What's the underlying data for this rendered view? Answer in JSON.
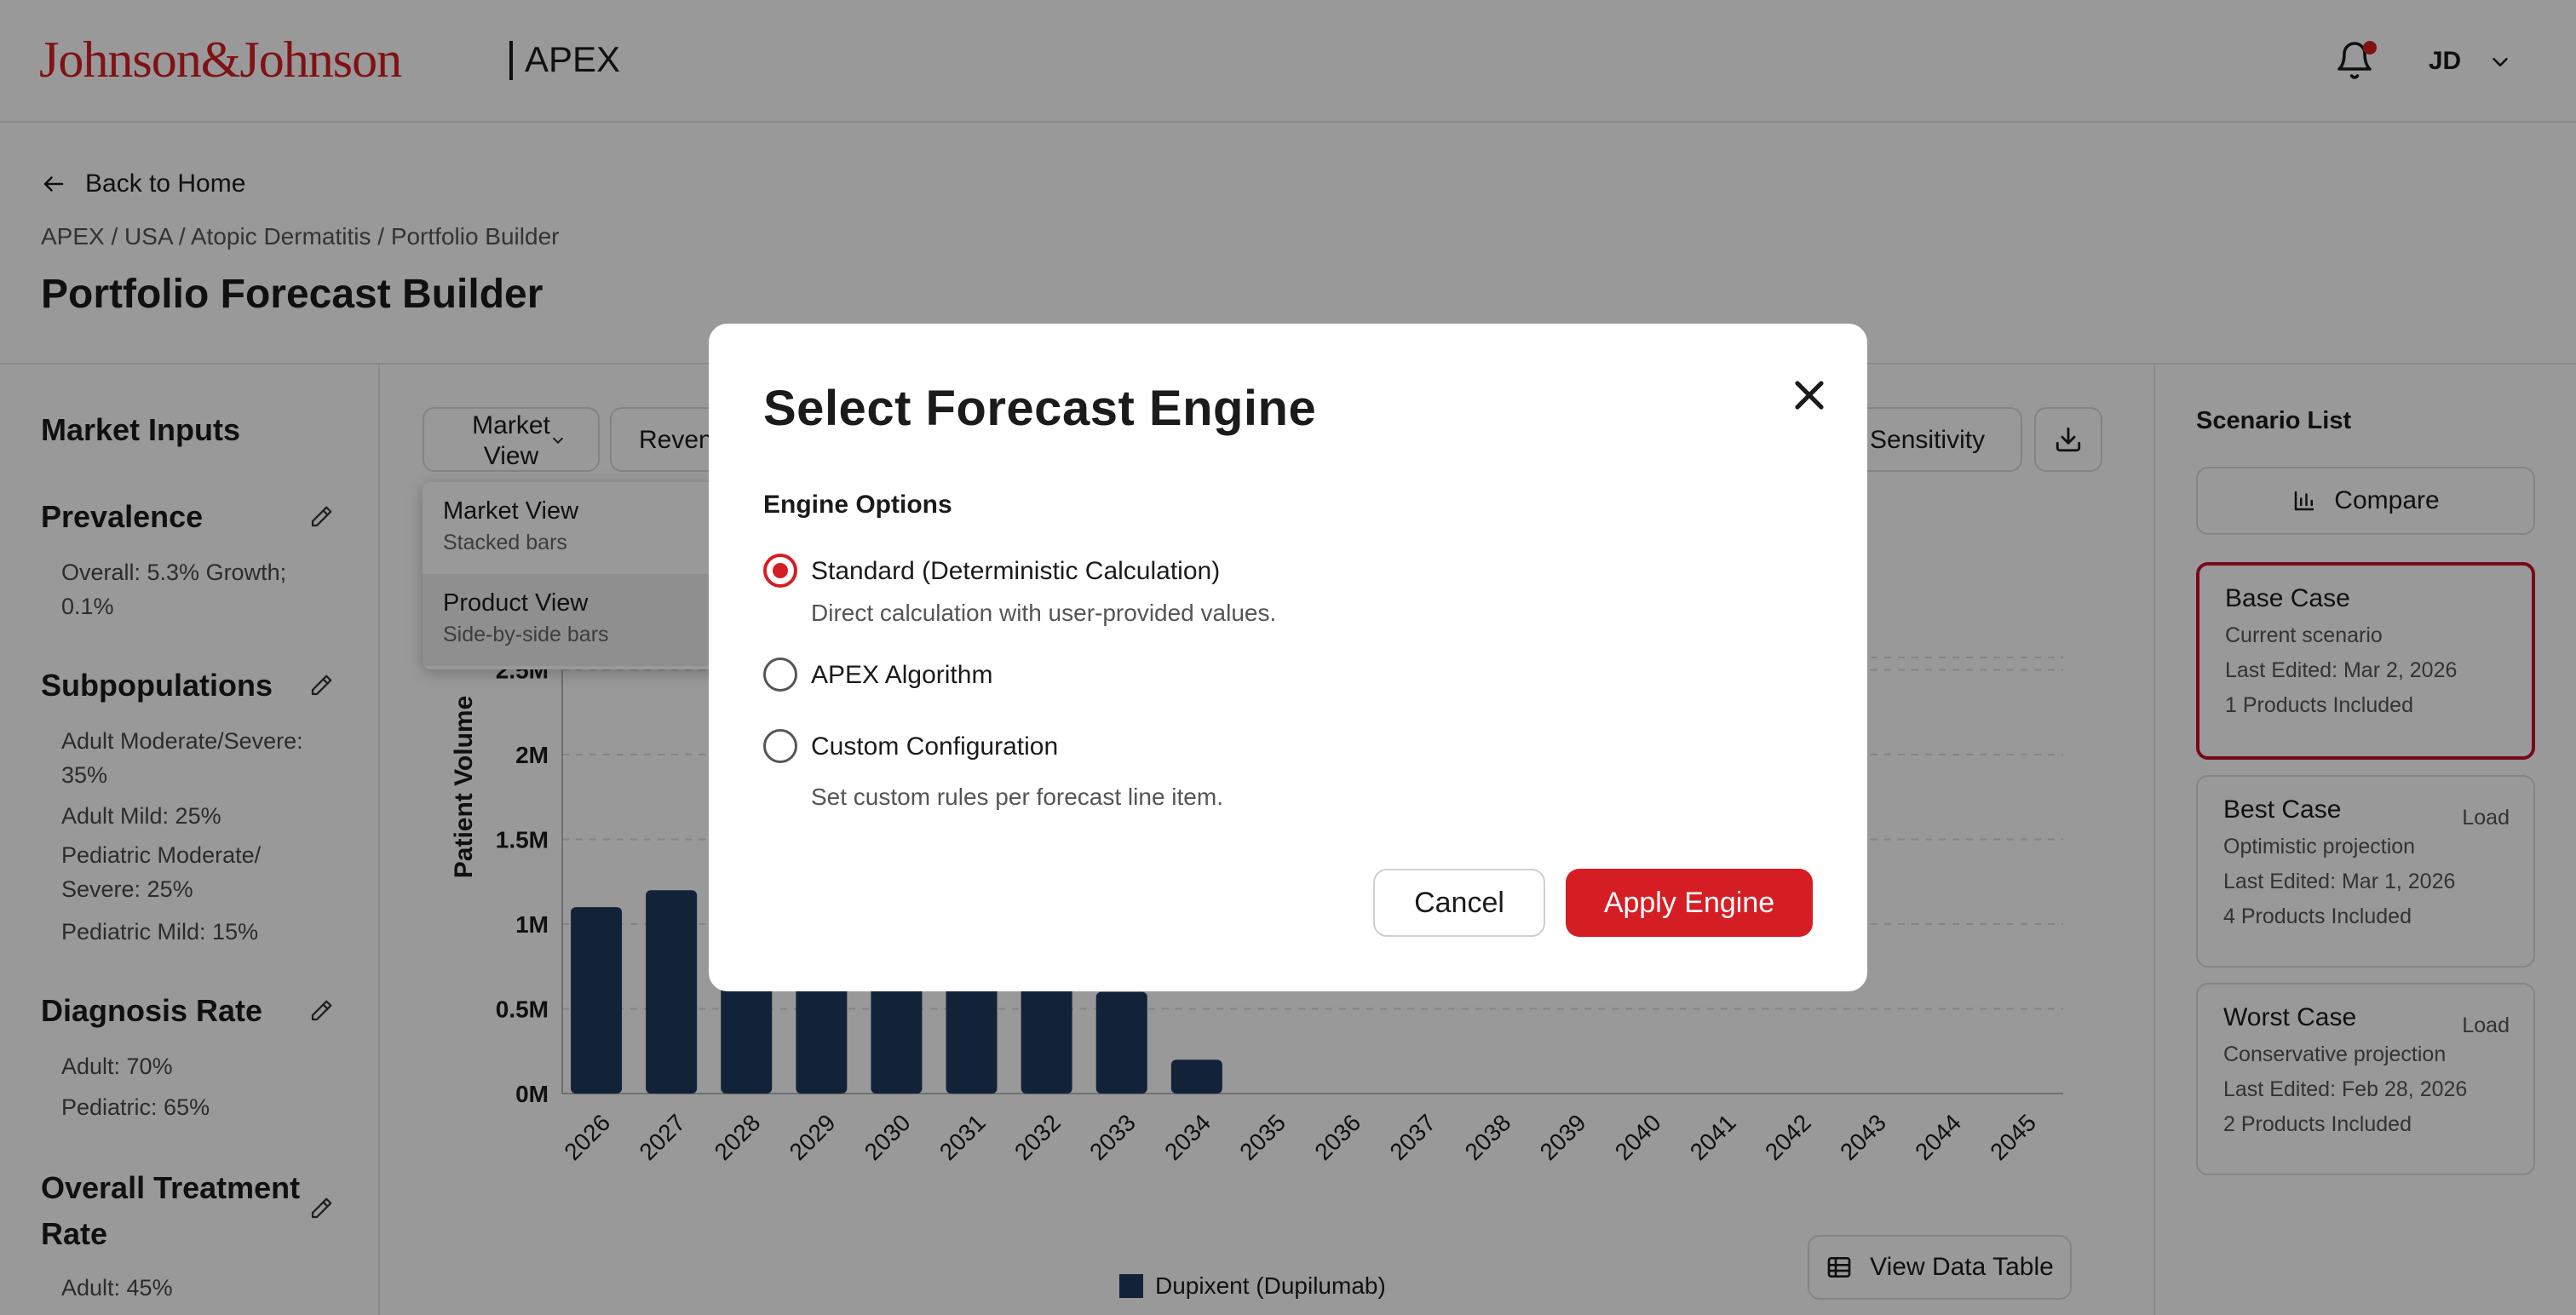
{
  "header": {
    "logo": "Johnson&Johnson",
    "app_name": "APEX",
    "user_initials": "JD"
  },
  "page": {
    "back_label": "Back to Home",
    "breadcrumb": "APEX / USA / Atopic Dermatitis / Portfolio Builder",
    "title": "Portfolio Forecast Builder"
  },
  "market_inputs": {
    "title": "Market Inputs",
    "prevalence": {
      "title": "Prevalence",
      "text": "Overall: 5.3% Growth; 0.1%"
    },
    "subpopulations": {
      "title": "Subpopulations",
      "items": [
        "Adult Moderate/Severe: 35%",
        "Adult Mild: 25%",
        "Pediatric Moderate/ Severe: 25%",
        "Pediatric Mild: 15%"
      ]
    },
    "diagnosis_rate": {
      "title": "Diagnosis Rate",
      "items": [
        "Adult: 70%",
        "Pediatric: 65%"
      ]
    },
    "treatment_rate": {
      "title": "Overall Treatment Rate",
      "items": [
        "Adult: 45%"
      ]
    }
  },
  "toolbar": {
    "market_view": "Market View",
    "revenue_partial": "Reven",
    "sensitivity_partial": "n Sensitivity",
    "view_data_table": "View Data Table"
  },
  "view_dropdown": [
    {
      "label": "Market View",
      "sub": "Stacked bars"
    },
    {
      "label": "Product View",
      "sub": "Side-by-side bars"
    }
  ],
  "chart_data": {
    "type": "bar",
    "ylabel": "Patient Volume",
    "xlabel": "",
    "ylim": [
      0,
      3000000
    ],
    "yticks": [
      "0M",
      "0.5M",
      "1M",
      "1.5M",
      "2M",
      "2.5M"
    ],
    "categories": [
      "2026",
      "2027",
      "2028",
      "2029",
      "2030",
      "2031",
      "2032",
      "2033",
      "2034",
      "2035",
      "2036",
      "2037",
      "2038",
      "2039",
      "2040",
      "2041",
      "2042",
      "2043",
      "2044",
      "2045"
    ],
    "series": [
      {
        "name": "Dupixent (Dupilumab)",
        "color": "#1f3a5f",
        "values": [
          1100000,
          1200000,
          1050000,
          1000000,
          950000,
          900000,
          850000,
          600000,
          200000,
          0,
          0,
          0,
          0,
          0,
          0,
          0,
          0,
          0,
          0,
          0
        ]
      }
    ]
  },
  "scenario_list": {
    "title": "Scenario List",
    "compare_label": "Compare",
    "cards": [
      {
        "name": "Base Case",
        "desc": "Current scenario",
        "edited": "Last Edited: Mar 2, 2026",
        "products": "1 Products Included",
        "load": ""
      },
      {
        "name": "Best Case",
        "desc": "Optimistic projection",
        "edited": "Last Edited: Mar 1, 2026",
        "products": "4 Products Included",
        "load": "Load"
      },
      {
        "name": "Worst Case",
        "desc": "Conservative projection",
        "edited": "Last Edited: Feb 28, 2026",
        "products": "2 Products Included",
        "load": "Load"
      }
    ]
  },
  "modal": {
    "title": "Select Forecast Engine",
    "options_label": "Engine Options",
    "options": [
      {
        "label": "Standard (Deterministic Calculation)",
        "desc": "Direct calculation with user-provided values.",
        "selected": true
      },
      {
        "label": "APEX Algorithm",
        "desc": "",
        "selected": false
      },
      {
        "label": "Custom Configuration",
        "desc": "Set custom rules per forecast line item.",
        "selected": false
      }
    ],
    "cancel_label": "Cancel",
    "apply_label": "Apply Engine"
  },
  "colors": {
    "brand_red": "#d51e24",
    "bar_navy": "#1f3a5f"
  }
}
